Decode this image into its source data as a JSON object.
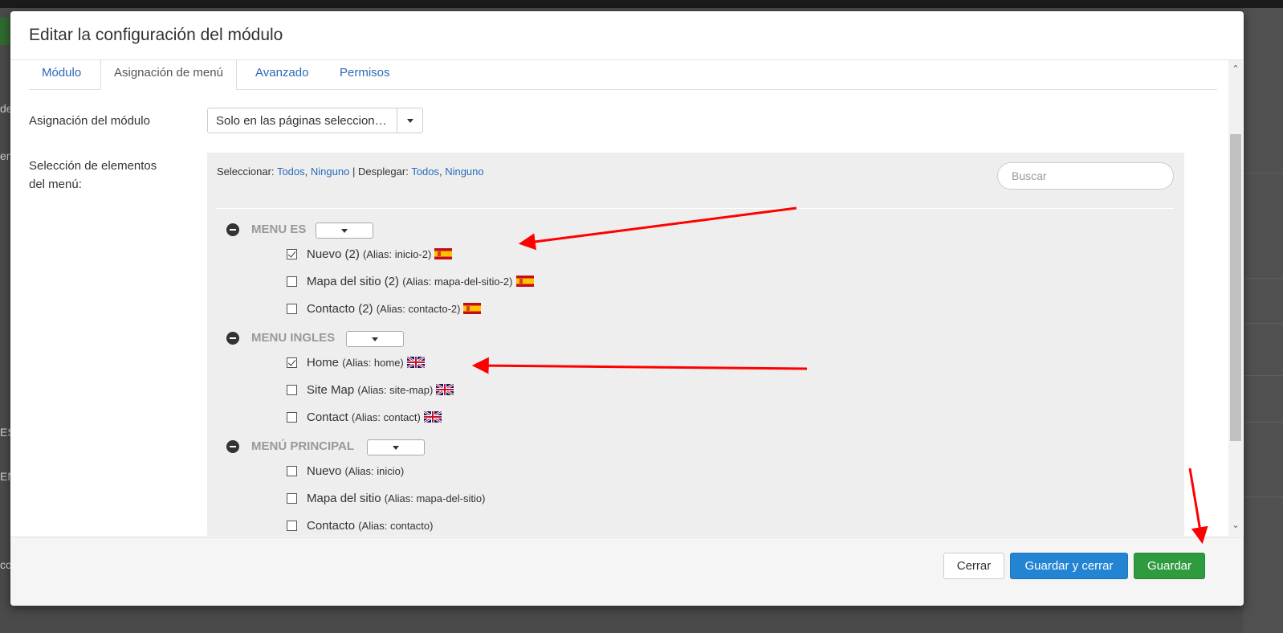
{
  "colors": {
    "accent": "#2a69b8",
    "primary": "#2384d3",
    "success": "#2f9b3f",
    "annotation": "#ff0000"
  },
  "background": {
    "side_text": [
      "de",
      "en",
      "ES",
      "EN",
      "cc"
    ]
  },
  "modal": {
    "title": "Editar la configuración del módulo"
  },
  "tabs": [
    {
      "label": "Módulo",
      "active": false
    },
    {
      "label": "Asignación de menú",
      "active": true
    },
    {
      "label": "Avanzado",
      "active": false
    },
    {
      "label": "Permisos",
      "active": false
    }
  ],
  "assignment": {
    "label": "Asignación del módulo",
    "value": "Solo en las páginas seleccionadas"
  },
  "selection": {
    "label_line1": "Selección de elementos",
    "label_line2": "del menú:",
    "tools": {
      "select_label": "Seleccionar:",
      "expand_label": "Desplegar:",
      "all": "Todos",
      "none": "Ninguno",
      "separator": "|",
      "comma": ","
    },
    "search_placeholder": "Buscar"
  },
  "menus": [
    {
      "title": "MENU ES",
      "items": [
        {
          "label": "Nuevo (2)",
          "alias": "(Alias: inicio-2)",
          "checked": true,
          "flag": "es"
        },
        {
          "label": "Mapa del sitio (2)",
          "alias": "(Alias: mapa-del-sitio-2)",
          "checked": false,
          "flag": "es"
        },
        {
          "label": "Contacto (2)",
          "alias": "(Alias: contacto-2)",
          "checked": false,
          "flag": "es"
        }
      ]
    },
    {
      "title": "MENU INGLES",
      "items": [
        {
          "label": "Home",
          "alias": "(Alias: home)",
          "checked": true,
          "flag": "gb"
        },
        {
          "label": "Site Map",
          "alias": "(Alias: site-map)",
          "checked": false,
          "flag": "gb"
        },
        {
          "label": "Contact",
          "alias": "(Alias: contact)",
          "checked": false,
          "flag": "gb"
        }
      ]
    },
    {
      "title": "MENÚ PRINCIPAL",
      "items": [
        {
          "label": "Nuevo",
          "alias": "(Alias: inicio)",
          "checked": false,
          "flag": ""
        },
        {
          "label": "Mapa del sitio",
          "alias": "(Alias: mapa-del-sitio)",
          "checked": false,
          "flag": ""
        },
        {
          "label": "Contacto",
          "alias": "(Alias: contacto)",
          "checked": false,
          "flag": ""
        }
      ]
    }
  ],
  "footer": {
    "close": "Cerrar",
    "save_close": "Guardar y cerrar",
    "save": "Guardar"
  }
}
